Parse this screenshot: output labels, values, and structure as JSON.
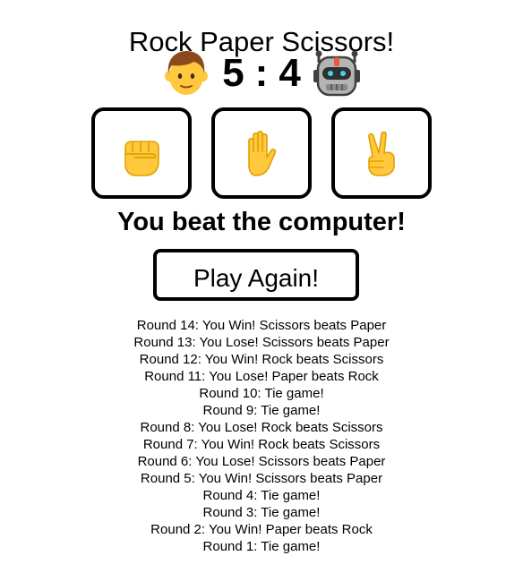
{
  "title": "Rock Paper Scissors!",
  "score": {
    "player": "5",
    "separator": ":",
    "computer": "4",
    "player_avatar_icon": "boy-face-icon",
    "computer_avatar_icon": "robot-face-icon"
  },
  "choices": [
    {
      "name": "Rock",
      "icon": "raised-fist-icon"
    },
    {
      "name": "Paper",
      "icon": "raised-hand-icon"
    },
    {
      "name": "Scissors",
      "icon": "victory-hand-icon"
    }
  ],
  "result_message": "You beat the computer!",
  "play_again_label": "Play Again!",
  "history": [
    "Round 14: You Win! Scissors beats Paper",
    "Round 13: You Lose! Scissors beats Paper",
    "Round 12: You Win! Rock beats Scissors",
    "Round 11: You Lose! Paper beats Rock",
    "Round 10: Tie game!",
    "Round 9: Tie game!",
    "Round 8: You Lose! Rock beats Scissors",
    "Round 7: You Win! Rock beats Scissors",
    "Round 6: You Lose! Scissors beats Paper",
    "Round 5: You Win! Scissors beats Paper",
    "Round 4: Tie game!",
    "Round 3: Tie game!",
    "Round 2: You Win! Paper beats Rock",
    "Round 1: Tie game!"
  ],
  "colors": {
    "emoji_yellow": "#FFC83D",
    "emoji_outline": "#E0A100",
    "hair_brown": "#8B4A1C",
    "robot_gray": "#B4B4B4",
    "robot_dark": "#404040",
    "robot_accent": "#E85A3C",
    "robot_eye": "#3FD4F0"
  }
}
